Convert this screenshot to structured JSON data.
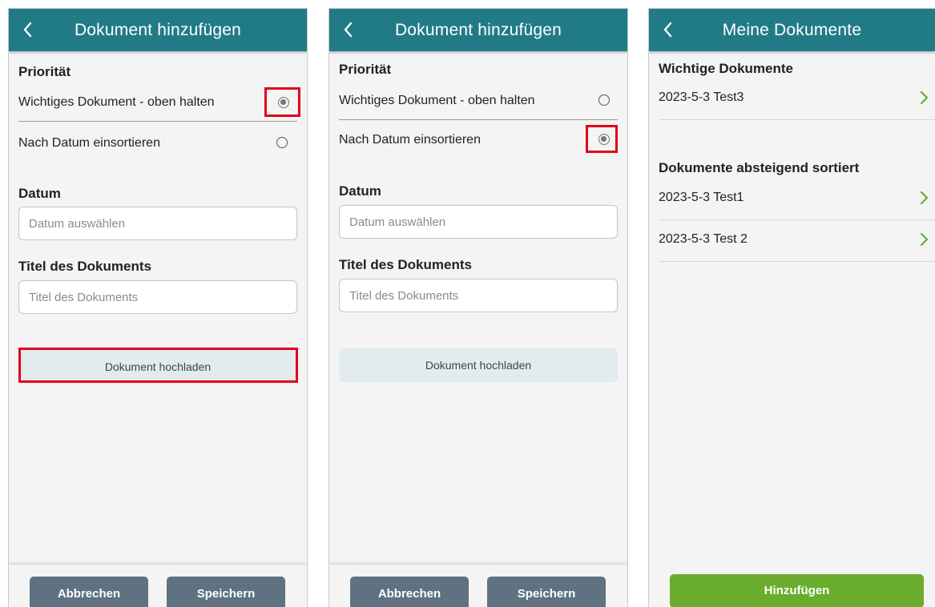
{
  "screen1": {
    "title": "Dokument hinzufügen",
    "priority_heading": "Priorität",
    "option_important": "Wichtiges Dokument - oben halten",
    "option_by_date": "Nach Datum einsortieren",
    "selected_option": "important",
    "date_heading": "Datum",
    "date_placeholder": "Datum auswählen",
    "doc_title_heading": "Titel des Dokuments",
    "doc_title_placeholder": "Titel des Dokuments",
    "upload_label": "Dokument hochladen",
    "cancel_label": "Abbrechen",
    "save_label": "Speichern"
  },
  "screen2": {
    "title": "Dokument hinzufügen",
    "priority_heading": "Priorität",
    "option_important": "Wichtiges Dokument - oben halten",
    "option_by_date": "Nach Datum einsortieren",
    "selected_option": "by_date",
    "date_heading": "Datum",
    "date_placeholder": "Datum auswählen",
    "doc_title_heading": "Titel des Dokuments",
    "doc_title_placeholder": "Titel des Dokuments",
    "upload_label": "Dokument hochladen",
    "cancel_label": "Abbrechen",
    "save_label": "Speichern"
  },
  "screen3": {
    "title": "Meine Dokumente",
    "important_heading": "Wichtige Dokumente",
    "important_items": [
      "2023-5-3  Test3"
    ],
    "sorted_heading": "Dokumente absteigend sortiert",
    "sorted_items": [
      "2023-5-3  Test1",
      "2023-5-3  Test 2"
    ],
    "add_label": "Hinzufügen"
  },
  "icons": {
    "back": "chevron-left-icon",
    "row_arrow": "chevron-right-icon"
  },
  "colors": {
    "header": "#217b86",
    "highlight": "#e3001b",
    "button_dark": "#5f7282",
    "button_green": "#6aad2c",
    "chevron": "#6aad2c"
  }
}
